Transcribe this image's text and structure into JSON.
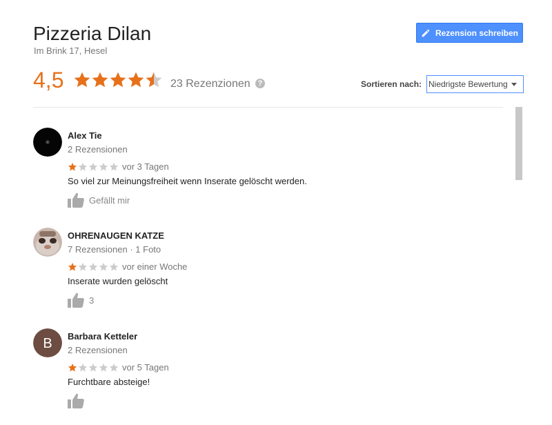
{
  "place": {
    "name": "Pizzeria Dilan",
    "address": "Im Brink 17, Hesel"
  },
  "write_review_label": "Rezension schreiben",
  "rating": {
    "value": "4,5",
    "stars": 4.5,
    "count_label": "23 Rezenzionen"
  },
  "help_glyph": "?",
  "sort": {
    "label": "Sortieren nach:",
    "selected": "Niedrigste Bewertung"
  },
  "colors": {
    "accent": "#e7711b",
    "button": "#4d90fe",
    "star_empty": "#cccccc"
  },
  "reviews": [
    {
      "name": "Alex Tie",
      "meta": "2 Rezensionen",
      "stars": 1,
      "time": "vor 3 Tagen",
      "text": "So viel zur Meinungsfreiheit wenn Inserate gelöscht werden.",
      "like_label": "Gefällt mir",
      "avatar_type": "photo-dark"
    },
    {
      "name": "OHRENAUGEN KATZE",
      "meta": "7 Rezensionen · 1 Foto",
      "stars": 1,
      "time": "vor einer Woche",
      "text": "Inserate wurden gelöscht",
      "like_label": "3",
      "avatar_type": "photo-cat"
    },
    {
      "name": "Barbara Ketteler",
      "meta": "2 Rezensionen",
      "stars": 1,
      "time": "vor 5 Tagen",
      "text": "Furchtbare absteige!",
      "like_label": "",
      "avatar_type": "letter",
      "avatar_letter": "B",
      "avatar_color": "#6d4c41"
    }
  ]
}
